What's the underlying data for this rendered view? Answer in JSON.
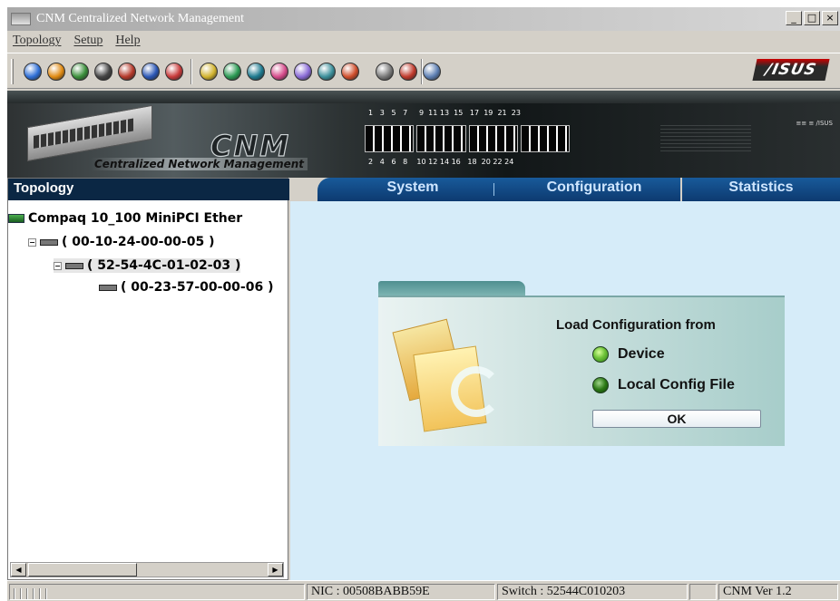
{
  "window": {
    "title": "CNM  Centralized Network Management",
    "controls": {
      "minimize": "_",
      "restore": "□",
      "close": "×"
    }
  },
  "menu": {
    "items": [
      "Topology",
      "Setup",
      "Help"
    ]
  },
  "toolbar": {
    "buttons": [
      {
        "name": "connect-icon",
        "color": "#2f6fd6"
      },
      {
        "name": "globe-icon",
        "color": "#e08a12"
      },
      {
        "name": "save-icon",
        "color": "#3a8f3a"
      },
      {
        "name": "device-icon",
        "color": "#444444"
      },
      {
        "name": "network-icon",
        "color": "#b5392a"
      },
      {
        "name": "help-icon",
        "color": "#2a56b5"
      },
      {
        "name": "compass-icon",
        "color": "#c83a3a"
      },
      {
        "name": "monitor-icon",
        "color": "#d1b32d"
      },
      {
        "name": "stats-icon",
        "color": "#2a9a53"
      },
      {
        "name": "refresh-icon",
        "color": "#1d7a8f"
      },
      {
        "name": "ping-icon",
        "color": "#d54a8a"
      },
      {
        "name": "schedule-icon",
        "color": "#8a6bd6"
      },
      {
        "name": "mail-icon",
        "color": "#3b8f9a"
      },
      {
        "name": "log-icon",
        "color": "#cf4d2b"
      },
      {
        "name": "printer-icon",
        "color": "#7a7a7a"
      },
      {
        "name": "tools-icon",
        "color": "#c0392b"
      },
      {
        "name": "users-icon",
        "color": "#5d7fb3"
      }
    ],
    "brand": "/ISUS"
  },
  "banner": {
    "logo": "CNM",
    "tagline": "Centralized Network Management",
    "top_ports": "1   3   5   7     9  11 13  15   17  19  21  23",
    "bottom_ports": "2   4   6   8    10 12 14 16   18  20 22 24",
    "panel_label": "≡≡ ≡ ∕ISUS"
  },
  "left_panel": {
    "title": "Topology",
    "tree": [
      {
        "label": "Compaq 10_100 MiniPCI Ether"
      },
      {
        "label": "( 00-10-24-00-00-05 )"
      },
      {
        "label": "( 52-54-4C-01-02-03 )"
      },
      {
        "label": "( 00-23-57-00-00-06 )"
      }
    ]
  },
  "tabs": [
    "System",
    "Configuration",
    "Statistics"
  ],
  "dialog": {
    "title": "Load Configuration from",
    "options": [
      "Device",
      "Local Config File"
    ],
    "ok_label": "OK",
    "colors": {
      "device": "#6fc43a",
      "local": "#2c7a16"
    }
  },
  "statusbar": {
    "nic": "NIC : 00508BABB59E",
    "switch": "Switch : 52544C010203",
    "version": "CNM Ver 1.2"
  }
}
